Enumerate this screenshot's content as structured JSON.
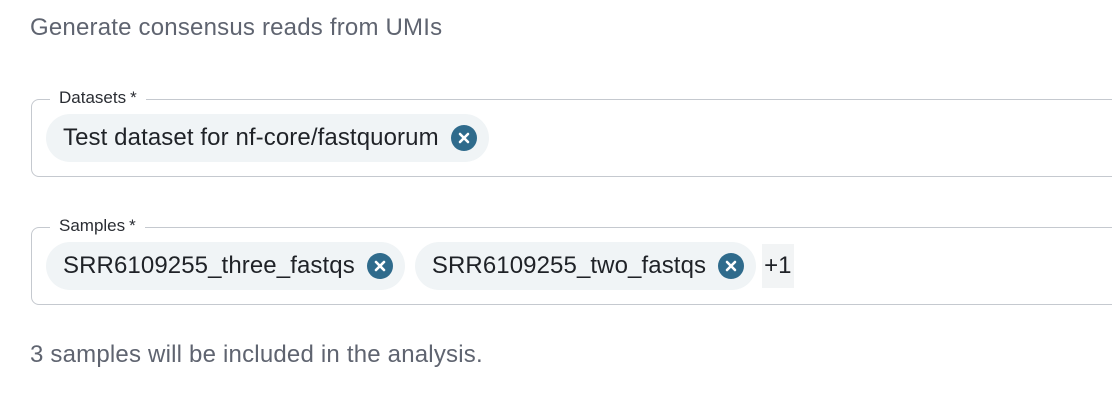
{
  "subtitle": "Generate consensus reads from UMIs",
  "datasets_field": {
    "label": "Datasets",
    "required_marker": "*",
    "chips": [
      {
        "label": "Test dataset for nf-core/fastquorum",
        "remove_icon": "close-circle-icon"
      }
    ]
  },
  "samples_field": {
    "label": "Samples",
    "required_marker": "*",
    "chips": [
      {
        "label": "SRR6109255_three_fastqs",
        "remove_icon": "close-circle-icon"
      },
      {
        "label": "SRR6109255_two_fastqs",
        "remove_icon": "close-circle-icon"
      }
    ],
    "more_count": "+1"
  },
  "helper_text": "3 samples will be included in the analysis.",
  "colors": {
    "accent": "#2f6b8c",
    "chip_background": "#f0f4f6",
    "border": "#c5c9cf",
    "muted_text": "#5f6470"
  }
}
